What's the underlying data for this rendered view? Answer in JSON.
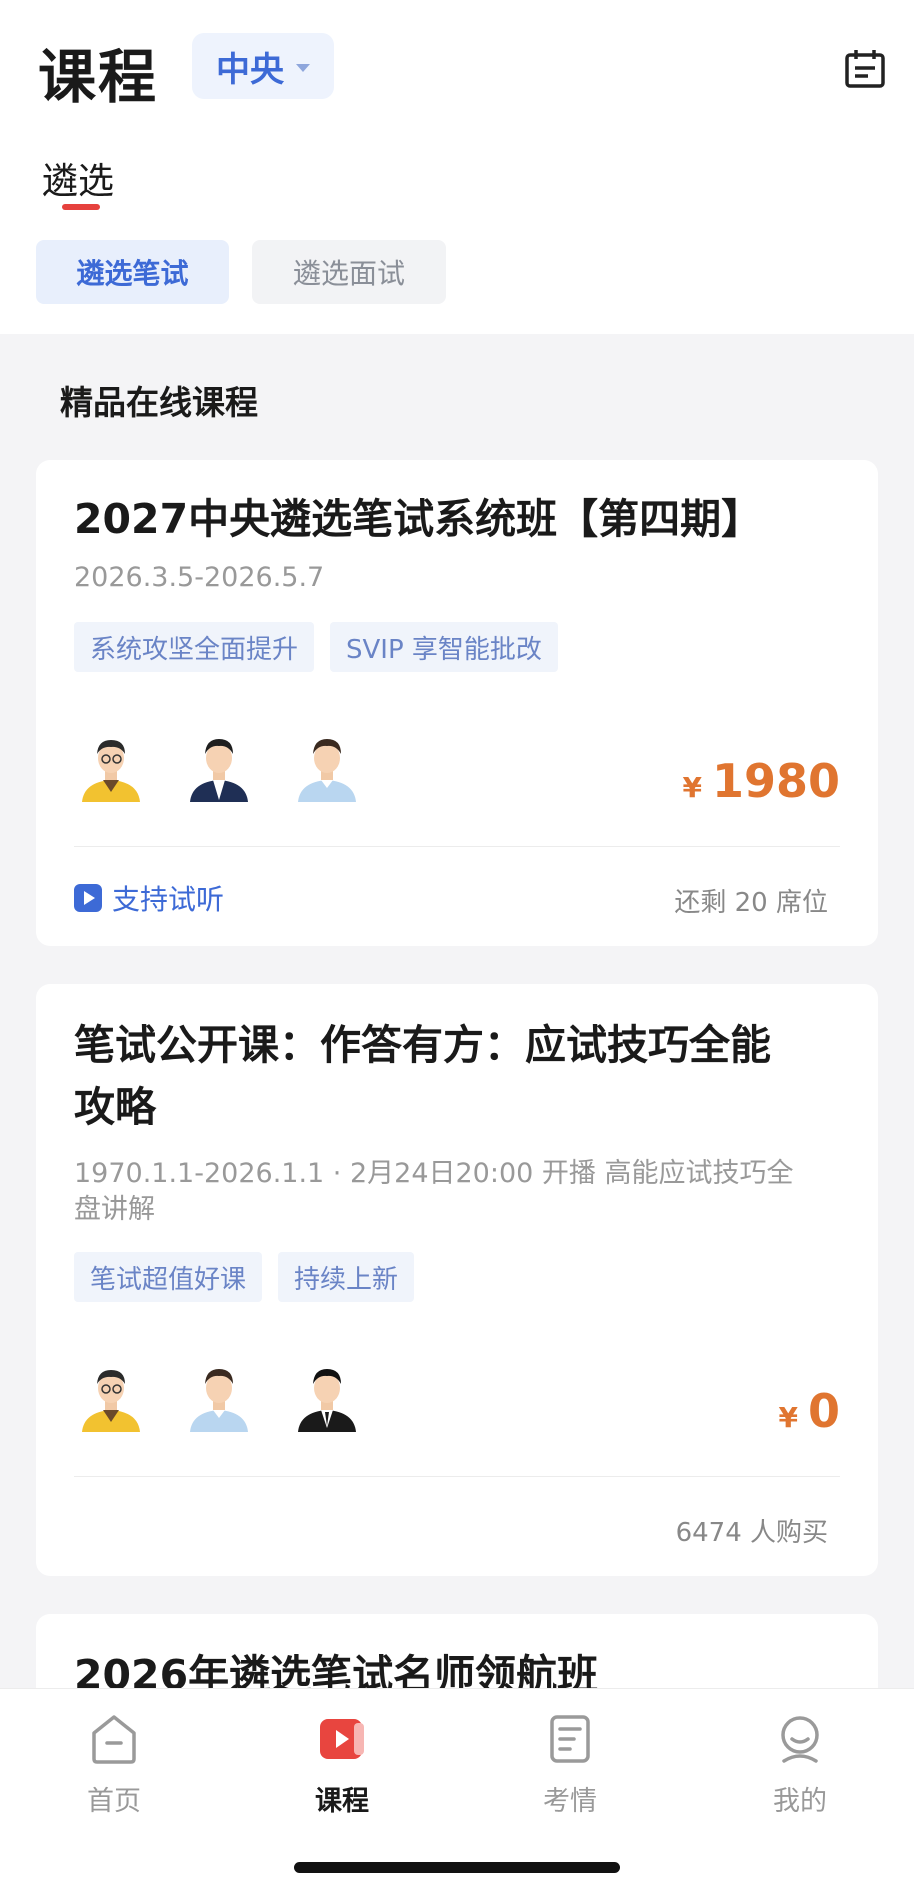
{
  "header": {
    "title": "课程",
    "region": "中央"
  },
  "category": {
    "label": "遴选"
  },
  "subtabs": [
    {
      "label": "遴选笔试",
      "active": true
    },
    {
      "label": "遴选面试",
      "active": false
    }
  ],
  "section": {
    "title": "精品在线课程"
  },
  "courses": [
    {
      "title": "2027中央遴选笔试系统班【第四期】",
      "subtitle": "2026.3.5-2026.5.7",
      "tags": [
        "系统攻坚全面提升",
        "SVIP 享智能批改"
      ],
      "currency": "¥",
      "price": "1980",
      "trial_label": "支持试听",
      "meta": "还剩 20 席位"
    },
    {
      "title_line1": "笔试公开课：作答有方：应试技巧全能",
      "title_line2": "攻略",
      "subtitle_line1": "1970.1.1-2026.1.1 · 2月24日20:00 开播 高能应试技巧全",
      "subtitle_line2": "盘讲解",
      "tags": [
        "笔试超值好课",
        "持续上新"
      ],
      "currency": "¥",
      "price": "0",
      "meta": "6474 人购买"
    },
    {
      "title": "2026年遴选笔试名师领航班"
    }
  ],
  "nav": [
    {
      "label": "首页",
      "icon": "home-icon",
      "active": false
    },
    {
      "label": "课程",
      "icon": "course-play-icon",
      "active": true
    },
    {
      "label": "考情",
      "icon": "exam-info-icon",
      "active": false
    },
    {
      "label": "我的",
      "icon": "profile-icon",
      "active": false
    }
  ],
  "colors": {
    "accent": "#3d6ad6",
    "price": "#e07530",
    "active_underline": "#e6413d",
    "nav_active": "#e8453f"
  }
}
